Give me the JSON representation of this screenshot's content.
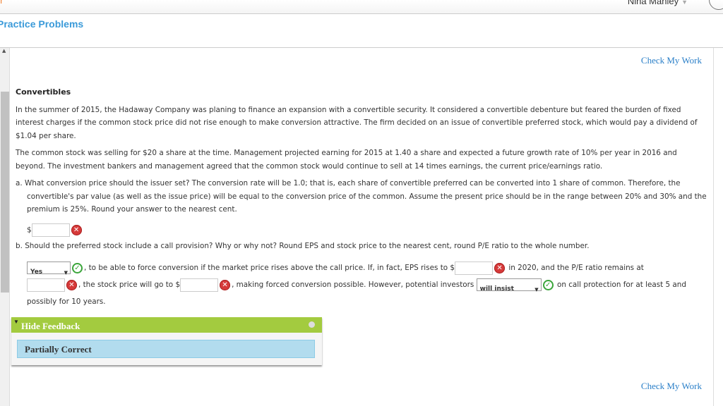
{
  "header": {
    "user_name": "Nina Manley",
    "page_title": "Practice Problems"
  },
  "check_my_work": "Check My Work",
  "problem": {
    "title": "Convertibles",
    "p1": "In the summer of 2015, the Hadaway Company was planing to finance an expansion with a convertible security. It considered a convertible debenture but feared the burden of fixed interest charges if the common stock price did not rise enough to make conversion attractive. The firm decided on an issue of convertible preferred stock, which would pay a dividend of $1.04 per share.",
    "p2": "The common stock was selling for $20 a share at the time. Management projected earning for 2015 at 1.40 a share and expected a future growth rate of 10% per year in 2016 and beyond. The investment bankers and management agreed that the common stock would continue to sell at 14 times earnings, the current price/earnings ratio.",
    "qa": "a. What conversion price should the issuer set? The conversion rate will be 1.0; that is, each share of convertible preferred can be converted into 1 share of common. Therefore, the convertible's par value (as well as the issue price) will be equal to the conversion price of the common. Assume the present price should be in the range between 20% and 30% and the premium is 25%. Round your answer to the nearest cent.",
    "qb": "b. Should the preferred stock include a call provision? Why or why not? Round EPS and stock price to the nearest cent, round P/E ratio to the whole number.",
    "dollar": "$",
    "select1": "Yes",
    "t1": ", to be able to force conversion if the market price rises above the call price. If, in fact, EPS rises to $",
    "t2": " in 2020, and the P/E ratio remains at",
    "t3": ", the stock price will go to $",
    "t4": ", making forced conversion possible. However, potential investors",
    "select2": "will insist",
    "t5": " on call protection for at least 5 and possibly for 10 years."
  },
  "feedback": {
    "toggle": "Hide Feedback",
    "status": "Partially Correct"
  },
  "colors": {
    "accent": "#3a9ad9",
    "feedback_green": "#a3cb3f",
    "feedback_blue": "#b2dcee",
    "error": "#d63a3a",
    "ok": "#3aa53a"
  }
}
